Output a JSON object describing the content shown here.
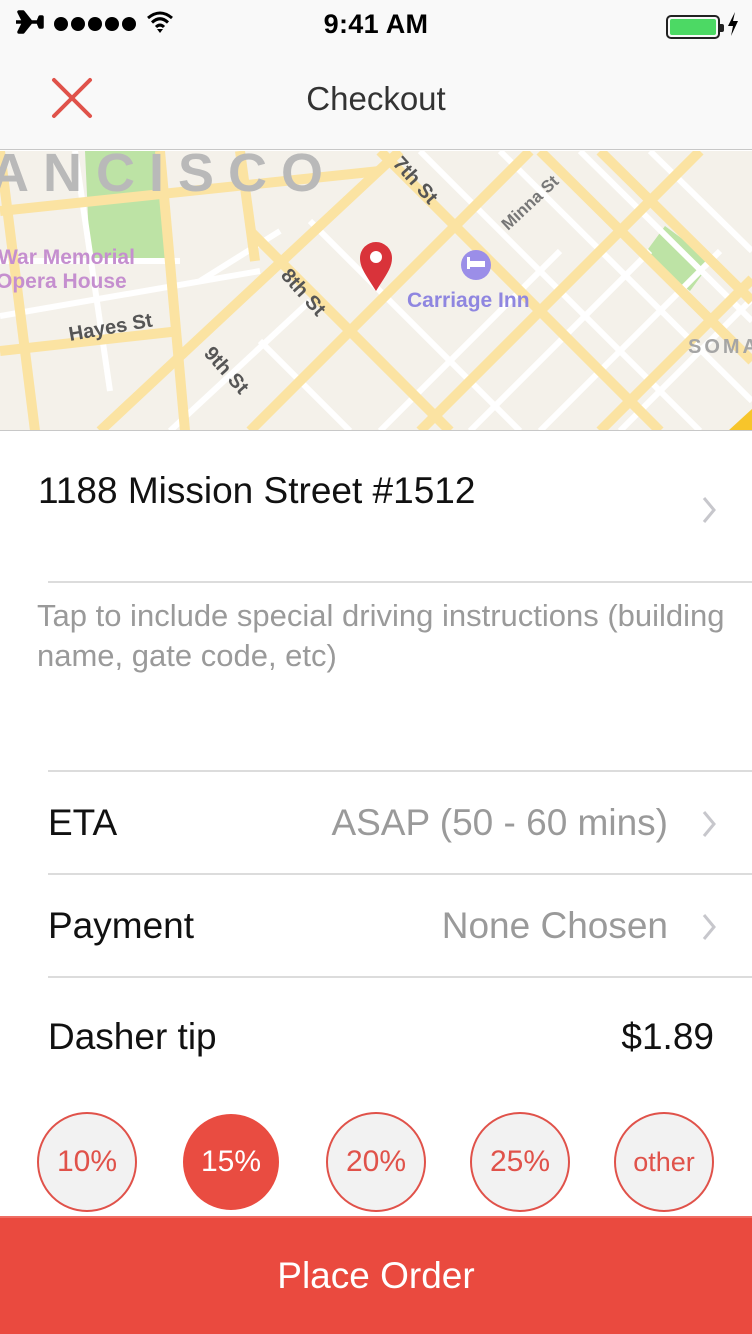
{
  "status_bar": {
    "time": "9:41 AM",
    "icons": [
      "airplane-icon",
      "signal-dots-icon",
      "wifi-icon",
      "battery-icon",
      "charging-bolt-icon"
    ],
    "signal_strength": 5,
    "battery_level": 1.0,
    "battery_color": "#4cd964"
  },
  "nav": {
    "title": "Checkout",
    "close_icon": "close-x-icon",
    "accent": "#e0524a"
  },
  "map": {
    "labels": {
      "district_top": "ANCISCO",
      "landmark": "War Memorial\nOpera House",
      "landmark_line1": "War Memorial",
      "landmark_line2": "Opera House",
      "hotel": "Carriage Inn",
      "district_right": "SOMA",
      "streets": [
        "7th St",
        "Minna St",
        "8th St",
        "Hayes St",
        "9th St"
      ]
    },
    "pin_color": "#d9333a",
    "hotel_icon": "bed-icon",
    "hotel_color": "#9b8ee8"
  },
  "address": {
    "text": "1188 Mission Street #1512",
    "chevron": "chevron-right-icon"
  },
  "instructions": {
    "placeholder": "Tap to include special driving instructions (building name, gate code, etc)"
  },
  "rows": {
    "eta": {
      "label": "ETA",
      "value": "ASAP (50 - 60 mins)"
    },
    "payment": {
      "label": "Payment",
      "value": "None Chosen"
    },
    "tip": {
      "label": "Dasher tip",
      "value": "$1.89"
    }
  },
  "tip_options": [
    {
      "label": "10%",
      "selected": false
    },
    {
      "label": "15%",
      "selected": true
    },
    {
      "label": "20%",
      "selected": false
    },
    {
      "label": "25%",
      "selected": false
    },
    {
      "label": "other",
      "selected": false
    }
  ],
  "place_order": {
    "label": "Place Order",
    "color": "#ea4a3f"
  }
}
